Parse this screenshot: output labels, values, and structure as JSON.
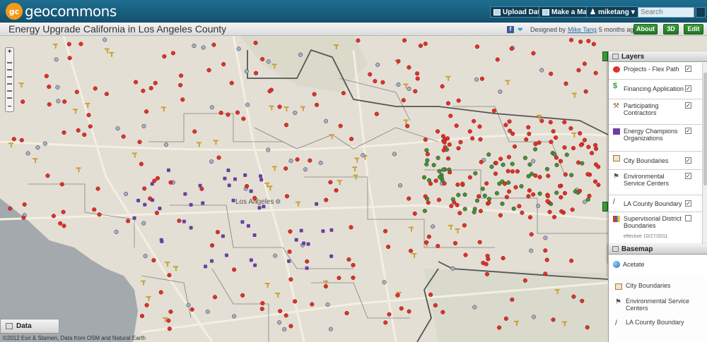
{
  "header": {
    "logo_mark": "gc",
    "logo_text": "geocommons",
    "upload_label": "Upload Data",
    "make_map_label": "Make a Map",
    "user_label": "miketang",
    "search_placeholder": "Search"
  },
  "titlebar": {
    "map_title": "Energy Upgrade California in Los Angeles County",
    "designed_by_prefix": "Designed by",
    "designer": "Mike Tang",
    "time_ago": "5 months ago",
    "about_label": "About",
    "three_d_label": "3D",
    "edit_label": "Edit"
  },
  "map": {
    "place_los_angeles": "Los Angeles",
    "attribution": "©2012 Esri & Stamen, Data from OSM and Natural Earth",
    "data_tab_label": "Data"
  },
  "layers_panel": {
    "title": "Layers",
    "items": [
      {
        "label": "Projects - Flex Path",
        "checked": true,
        "icon": "red-dot-icon"
      },
      {
        "label": "Financing Application",
        "checked": true,
        "icon": "dollar-icon"
      },
      {
        "label": "Participating Contractors",
        "checked": true,
        "icon": "hammer-icon"
      },
      {
        "label": "Energy Champions Organizations",
        "checked": true,
        "icon": "purple-square-icon"
      },
      {
        "label": "City Boundaries",
        "checked": true,
        "icon": "boundary-icon"
      },
      {
        "label": "Environmental Service Centers",
        "checked": true,
        "icon": "flag-icon"
      },
      {
        "label": "LA County Boundary",
        "checked": true,
        "icon": "line-icon"
      },
      {
        "label": "Supervisorial District Boundaries",
        "checked": false,
        "icon": "district-icon"
      }
    ],
    "cut_off_text": "effective 10/27/2011"
  },
  "basemap_panel": {
    "title": "Basemap",
    "selected": "Acetate"
  },
  "legend_below": {
    "items": [
      "City Boundaries",
      "Environmental Service Centers",
      "LA County Boundary"
    ]
  },
  "colors": {
    "topbar": "#1a5f80",
    "accent_green": "#2f8a2f",
    "project_red": "#e0312b",
    "champion_purple": "#6a3fa0",
    "finance_green": "#2e9c3c",
    "contractor_gold": "#c9a13a"
  }
}
